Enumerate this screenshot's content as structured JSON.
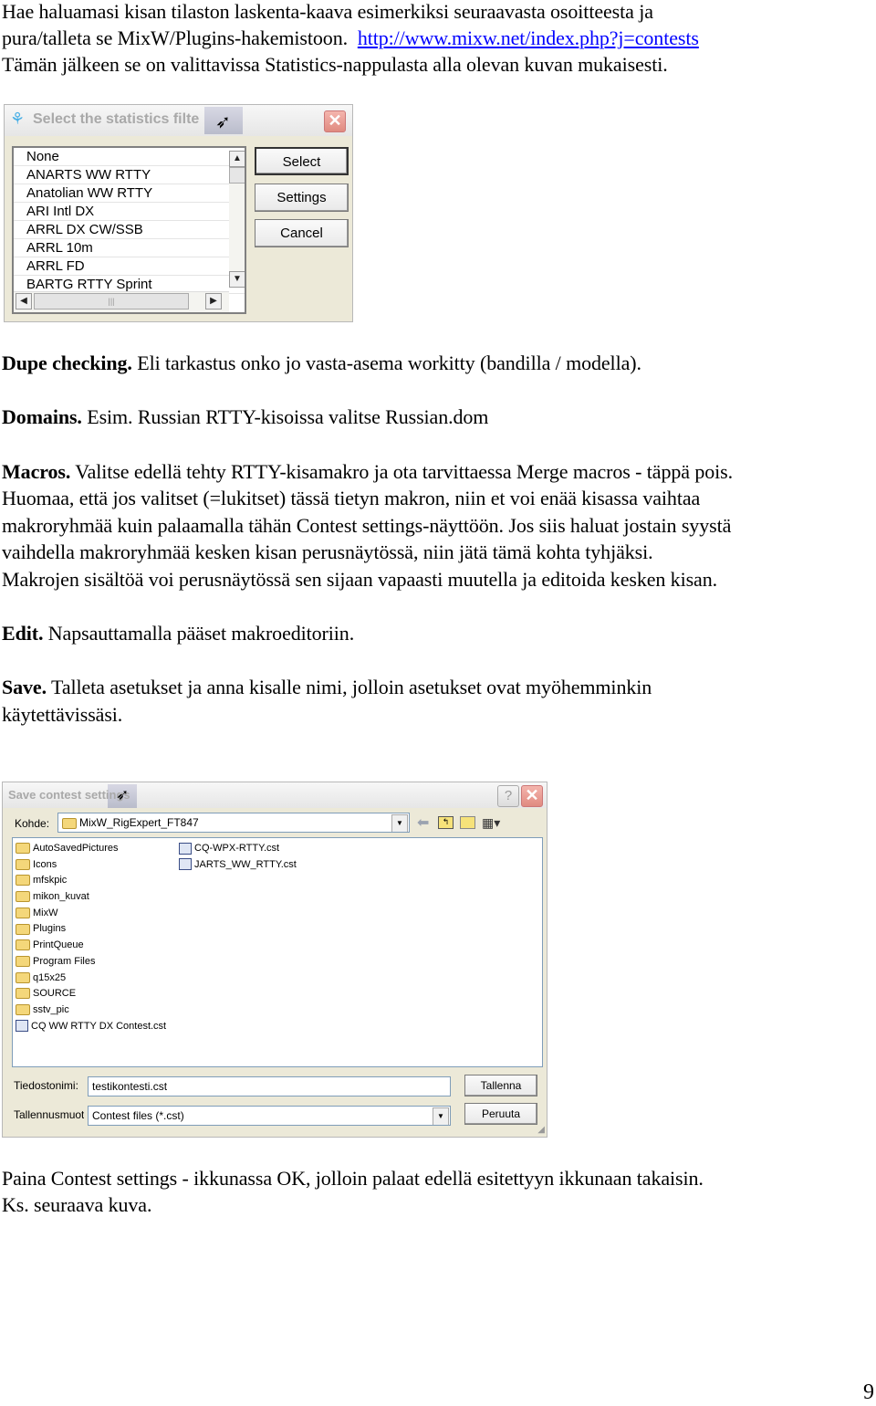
{
  "intro": {
    "line1": "Hae haluamasi kisan tilaston laskenta-kaava esimerkiksi seuraavasta osoitteesta ja",
    "line2_text": "pura/talleta se MixW/Plugins-hakemistoon.",
    "line2_link": "http://www.mixw.net/index.php?j=contests",
    "line3": "Tämän jälkeen se on valittavissa Statistics-nappulasta alla olevan kuvan mukaisesti."
  },
  "stats_dialog": {
    "title": "Select the statistics filte",
    "items": [
      "None",
      "ANARTS WW RTTY",
      "Anatolian WW RTTY",
      "ARI Intl DX",
      "ARRL DX CW/SSB",
      "ARRL 10m",
      "ARRL FD",
      "BARTG RTTY Sprint"
    ],
    "buttons": {
      "select": "Select",
      "settings": "Settings",
      "cancel": "Cancel"
    },
    "close_glyph": "✕"
  },
  "sections": {
    "dupe": {
      "title": "Dupe checking.",
      "text": " Eli tarkastus onko jo vasta-asema workitty (bandilla / modella)."
    },
    "domains": {
      "title": "Domains.",
      "text": " Esim. Russian RTTY-kisoissa valitse Russian.dom"
    },
    "macros": {
      "title": "Macros.",
      "text": " Valitse edellä tehty RTTY-kisamakro ja ota tarvittaessa Merge macros - täppä pois.",
      "lines": [
        "Huomaa, että jos valitset (=lukitset) tässä tietyn makron, niin et voi enää kisassa vaihtaa",
        "makroryhmää kuin palaamalla tähän Contest settings-näyttöön.  Jos siis haluat jostain syystä",
        "vaihdella makroryhmää kesken kisan perusnäytössä, niin jätä tämä kohta tyhjäksi.",
        "Makrojen sisältöä  voi perusnäytössä sen sijaan vapaasti muutella ja editoida kesken kisan."
      ]
    },
    "edit": {
      "title": "Edit.",
      "text": " Napsauttamalla pääset makroeditoriin."
    },
    "save": {
      "title": "Save.",
      "text": " Talleta asetukset ja anna kisalle nimi, jolloin asetukset ovat myöhemminkin",
      "line2": "käytettävissäsi."
    }
  },
  "save_dialog": {
    "title": "Save contest settings",
    "help_glyph": "?",
    "close_glyph": "✕",
    "location_label": "Kohde:",
    "location_value": "MixW_RigExpert_FT847",
    "folders": [
      "AutoSavedPictures",
      "Icons",
      "mfskpic",
      "mikon_kuvat",
      "MixW",
      "Plugins",
      "PrintQueue",
      "Program Files",
      "q15x25",
      "SOURCE",
      "sstv_pic"
    ],
    "files_col1": [
      "CQ WW RTTY DX Contest.cst"
    ],
    "files_col2": [
      "CQ-WPX-RTTY.cst",
      "JARTS_WW_RTTY.cst"
    ],
    "filename_label": "Tiedostonimi:",
    "filename_value": "testikontesti.cst",
    "filetype_label": "Tallennusmuoto",
    "filetype_value": "Contest files (*.cst)",
    "save_button": "Tallenna",
    "cancel_button": "Peruuta"
  },
  "outro": {
    "line1": "Paina Contest settings -  ikkunassa OK, jolloin palaat edellä esitettyyn ikkunaan takaisin.",
    "line2": "Ks. seuraava kuva."
  },
  "page_number": "9"
}
